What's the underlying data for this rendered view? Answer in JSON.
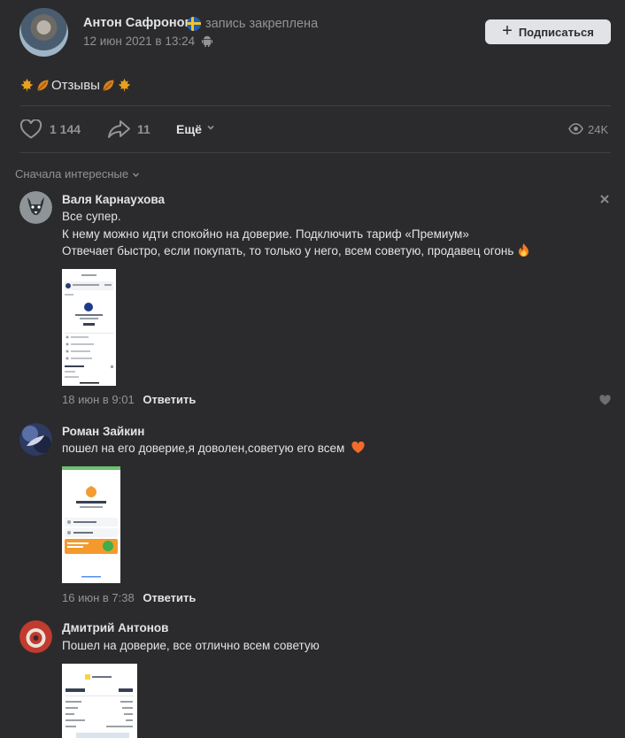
{
  "post": {
    "author": "Антон Сафронов",
    "pinned_label": "запись закреплена",
    "date": "12 июн 2021 в 13:24",
    "subscribe_label": "Подписаться",
    "text": "Отзывы",
    "likes": "1 144",
    "shares": "11",
    "more_label": "Ещё",
    "views": "24K"
  },
  "comments_header": {
    "sort_label": "Сначала интересные"
  },
  "comments": [
    {
      "author": "Валя Карнаухова",
      "lines": [
        "Все супер.",
        "К нему можно идти спокойно на доверие. Подключить тариф «Премиум»",
        "Отвечает быстро, если покупать, то только у него, всем советую, продавец огонь"
      ],
      "date": "18 июн в 9:01",
      "reply_label": "Ответить"
    },
    {
      "author": "Роман Зайкин",
      "lines": [
        "пошел на его доверие,я доволен,советую его всем"
      ],
      "date": "16 июн в 7:38",
      "reply_label": "Ответить"
    },
    {
      "author": "Дмитрий Антонов",
      "lines": [
        "Пошел на доверие, все отлично всем советую"
      ]
    }
  ],
  "icons": {
    "like": "heart-outline-icon",
    "share": "share-arrow-icon",
    "views": "eye-icon",
    "close": "close-icon",
    "comment_like": "heart-icon"
  },
  "colors": {
    "background": "#2b2b2d",
    "text": "#e1e3e6",
    "secondary": "#939393",
    "button": "#e1e3e6"
  }
}
